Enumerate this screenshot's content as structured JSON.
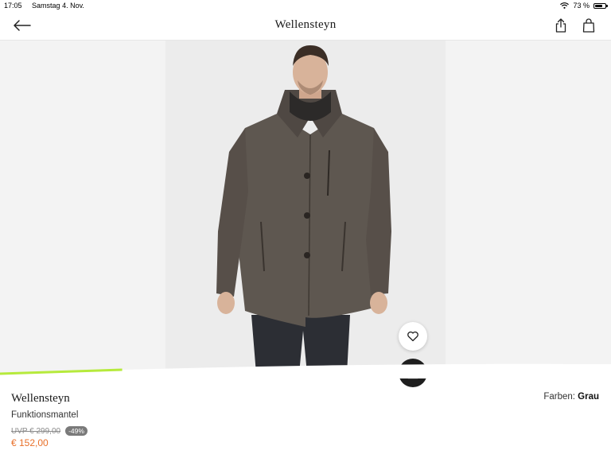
{
  "status_bar": {
    "time": "17:05",
    "date": "Samstag 4. Nov.",
    "battery_percent": "73 %",
    "battery_level": 0.73
  },
  "nav": {
    "title": "Wellensteyn",
    "back_icon": "arrow-left-icon",
    "share_icon": "share-icon",
    "bag_icon": "shopping-bag-icon"
  },
  "product": {
    "brand": "Wellensteyn",
    "name": "Funktionsmantel",
    "uvp_price": "UVP € 299,00",
    "discount": "-49%",
    "price": "€ 152,00",
    "colors_label": "Farben:",
    "color_value": "Grau"
  },
  "gallery": {
    "progress": 0.2,
    "accent_color": "#b6ea3c",
    "coat_color": "#5e5750",
    "wishlist_icon": "heart-icon",
    "add_icon": "bag-plus-icon"
  }
}
